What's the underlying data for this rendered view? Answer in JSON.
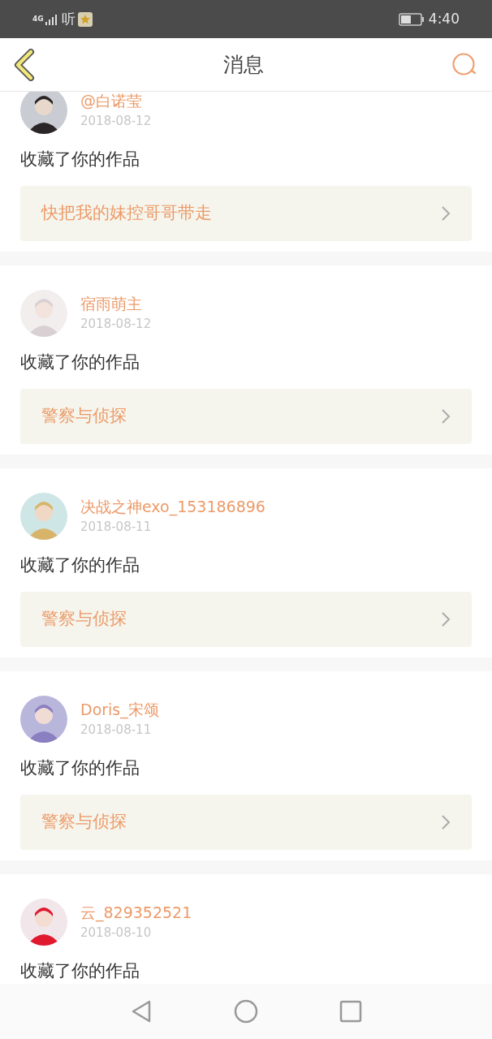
{
  "status_bar": {
    "network": "4G",
    "app_glyph": "听",
    "time": "4:40"
  },
  "header": {
    "title": "消息"
  },
  "messages": [
    {
      "user": "@白诺莹",
      "date": "2018-08-12",
      "action": "收藏了你的作品",
      "work": "快把我的妹控哥哥带走"
    },
    {
      "user": "宿雨萌主",
      "date": "2018-08-12",
      "action": "收藏了你的作品",
      "work": "警察与侦探"
    },
    {
      "user": "决战之神exo_153186896",
      "date": "2018-08-11",
      "action": "收藏了你的作品",
      "work": "警察与侦探"
    },
    {
      "user": "Doris_宋颂",
      "date": "2018-08-11",
      "action": "收藏了你的作品",
      "work": "警察与侦探"
    },
    {
      "user": "云_829352521",
      "date": "2018-08-10",
      "action": "收藏了你的作品"
    }
  ]
}
